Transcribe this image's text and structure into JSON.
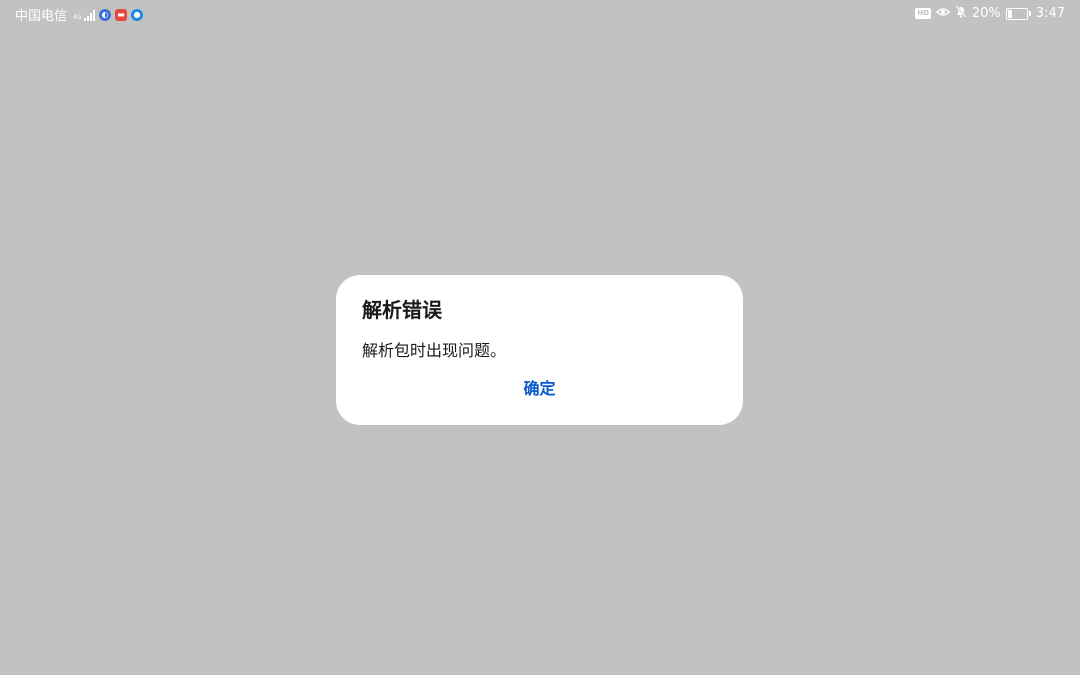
{
  "status_bar": {
    "carrier": "中国电信",
    "network_type": "4G",
    "battery_percent": "20%",
    "battery_level": 0.2,
    "time": "3:47",
    "left_icons": [
      "signal-icon",
      "app-notification-icon-1",
      "app-notification-icon-2",
      "app-notification-icon-3"
    ],
    "right_icons": [
      "hd-icon",
      "eye-comfort-icon",
      "mute-bell-icon",
      "battery-charging-icon"
    ]
  },
  "dialog": {
    "title": "解析错误",
    "message": "解析包时出现问题。",
    "confirm_label": "确定"
  },
  "colors": {
    "background": "#c1c2c4",
    "dialog_background": "#ffffff",
    "accent": "#0a59c8",
    "text": "#1a1a1a"
  }
}
